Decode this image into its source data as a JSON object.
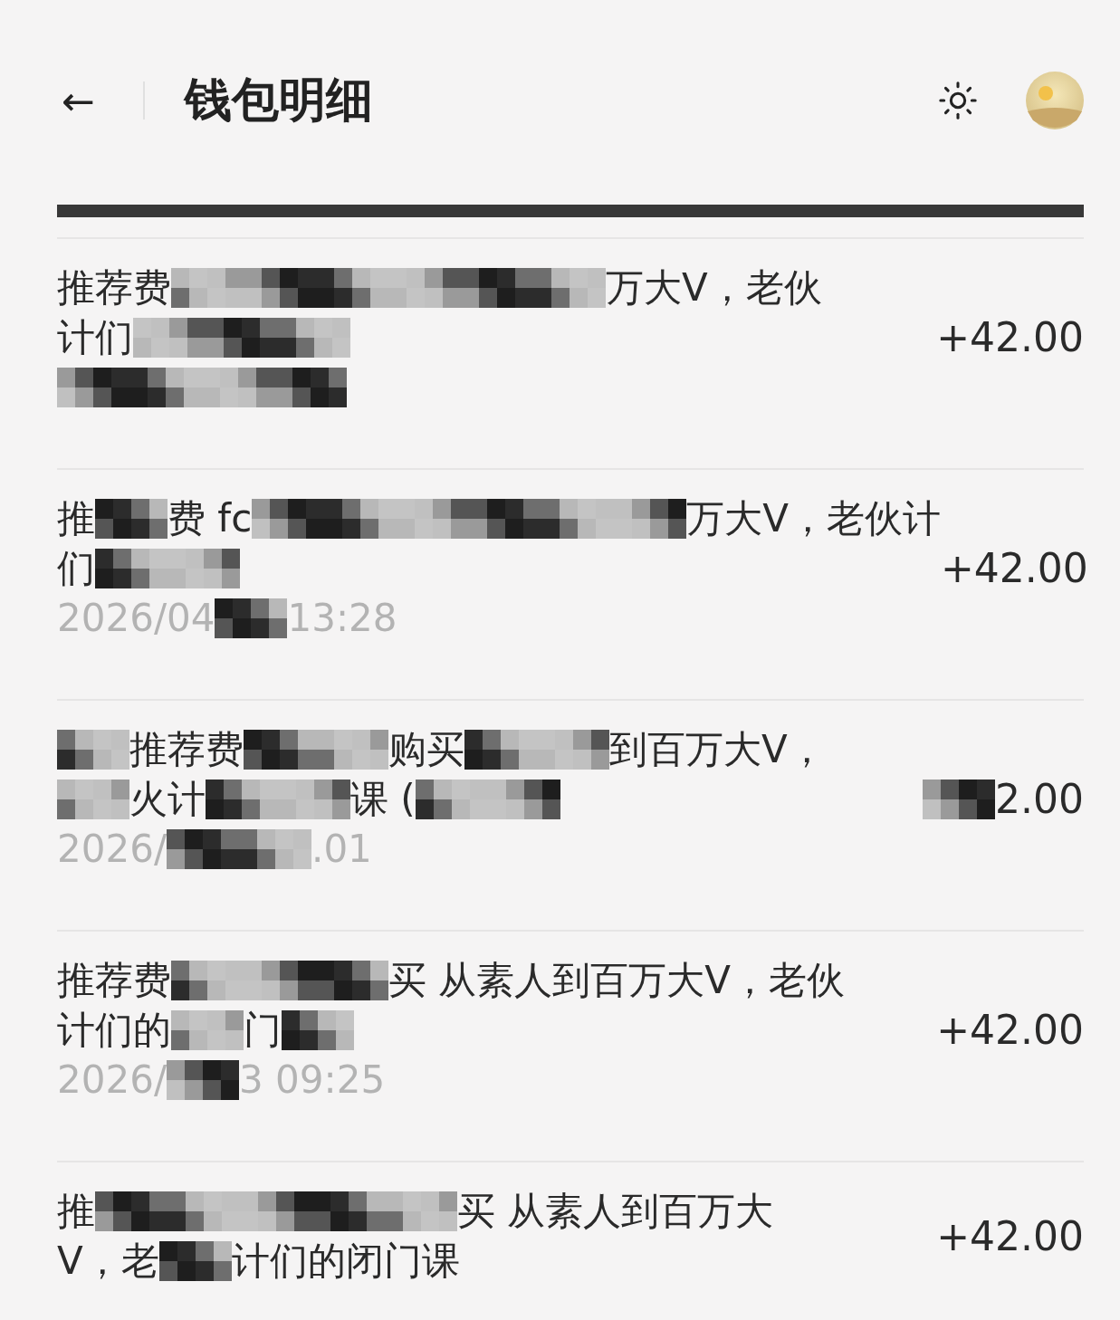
{
  "header": {
    "back": "←",
    "title": "钱包明细"
  },
  "rows": [
    {
      "lines": [
        [
          {
            "kind": "text",
            "text": "推荐费"
          },
          {
            "kind": "mosaic"
          },
          {
            "kind": "mosaic"
          },
          {
            "kind": "mosaic"
          },
          {
            "kind": "mosaic"
          },
          {
            "kind": "mosaic"
          },
          {
            "kind": "mosaic"
          },
          {
            "kind": "text",
            "text": "万大V，老伙"
          }
        ],
        [
          {
            "kind": "text",
            "text": "计们"
          },
          {
            "kind": "mosaic"
          },
          {
            "kind": "mosaic"
          },
          {
            "kind": "mosaic"
          }
        ]
      ],
      "time": [
        {
          "kind": "mosaic"
        },
        {
          "kind": "mosaic"
        },
        {
          "kind": "mosaic"
        },
        {
          "kind": "mosaic"
        }
      ],
      "amount": [
        {
          "kind": "text",
          "text": "+42.00"
        }
      ]
    },
    {
      "lines": [
        [
          {
            "kind": "text",
            "text": "推"
          },
          {
            "kind": "mosaic"
          },
          {
            "kind": "text",
            "text": "费 fc"
          },
          {
            "kind": "mosaic"
          },
          {
            "kind": "mosaic"
          },
          {
            "kind": "mosaic"
          },
          {
            "kind": "mosaic"
          },
          {
            "kind": "mosaic"
          },
          {
            "kind": "mosaic"
          },
          {
            "kind": "text",
            "text": "万大V，老伙计"
          }
        ],
        [
          {
            "kind": "text",
            "text": "们"
          },
          {
            "kind": "mosaic"
          },
          {
            "kind": "mosaic"
          }
        ]
      ],
      "time": [
        {
          "kind": "text",
          "text": "2026/04"
        },
        {
          "kind": "mosaic"
        },
        {
          "kind": "text",
          "text": "13:28"
        }
      ],
      "amount": [
        {
          "kind": "text",
          "text": "+42.00"
        }
      ]
    },
    {
      "lines": [
        [
          {
            "kind": "mosaic"
          },
          {
            "kind": "text",
            "text": "推荐费"
          },
          {
            "kind": "mosaic"
          },
          {
            "kind": "mosaic"
          },
          {
            "kind": "text",
            "text": "购买"
          },
          {
            "kind": "mosaic"
          },
          {
            "kind": "mosaic"
          },
          {
            "kind": "text",
            "text": "到百万大V，"
          }
        ],
        [
          {
            "kind": "mosaic"
          },
          {
            "kind": "text",
            "text": "火计"
          },
          {
            "kind": "mosaic"
          },
          {
            "kind": "mosaic"
          },
          {
            "kind": "text",
            "text": "课 ("
          },
          {
            "kind": "mosaic"
          },
          {
            "kind": "mosaic"
          }
        ]
      ],
      "time": [
        {
          "kind": "text",
          "text": "2026/"
        },
        {
          "kind": "mosaic"
        },
        {
          "kind": "mosaic"
        },
        {
          "kind": "text",
          "text": ".01"
        }
      ],
      "amount": [
        {
          "kind": "mosaic"
        },
        {
          "kind": "text",
          "text": "2.00"
        }
      ]
    },
    {
      "lines": [
        [
          {
            "kind": "text",
            "text": "推荐费"
          },
          {
            "kind": "mosaic"
          },
          {
            "kind": "mosaic"
          },
          {
            "kind": "mosaic"
          },
          {
            "kind": "text",
            "text": "买 从素人到百万大V，老伙"
          }
        ],
        [
          {
            "kind": "text",
            "text": "计们的"
          },
          {
            "kind": "mosaic"
          },
          {
            "kind": "text",
            "text": "门"
          },
          {
            "kind": "mosaic"
          }
        ]
      ],
      "time": [
        {
          "kind": "text",
          "text": "2026/"
        },
        {
          "kind": "mosaic"
        },
        {
          "kind": "text",
          "text": "3 09:25"
        }
      ],
      "amount": [
        {
          "kind": "text",
          "text": "+42.00"
        }
      ]
    },
    {
      "lines": [
        [
          {
            "kind": "text",
            "text": "推"
          },
          {
            "kind": "mosaic"
          },
          {
            "kind": "mosaic"
          },
          {
            "kind": "mosaic"
          },
          {
            "kind": "mosaic"
          },
          {
            "kind": "mosaic"
          },
          {
            "kind": "text",
            "text": "买 从素人到百万大"
          }
        ],
        [
          {
            "kind": "text",
            "text": "V，老"
          },
          {
            "kind": "mosaic"
          },
          {
            "kind": "text",
            "text": "计们的闭门课"
          }
        ]
      ],
      "amount": [
        {
          "kind": "text",
          "text": "+42.00"
        }
      ]
    }
  ]
}
